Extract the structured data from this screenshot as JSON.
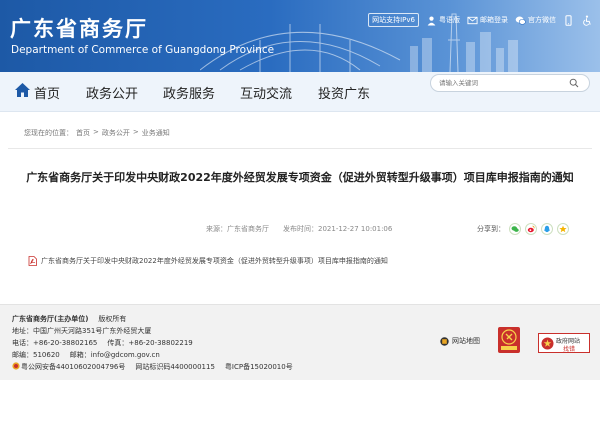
{
  "header": {
    "title": "广东省商务厅",
    "subtitle": "Department of Commerce of Guangdong Province",
    "ipv6_badge": "网站支持IPv6",
    "links": [
      {
        "label": "粤语版",
        "icon": "person-icon"
      },
      {
        "label": "邮箱登录",
        "icon": "mail-icon"
      },
      {
        "label": "官方微信",
        "icon": "wechat-icon"
      },
      {
        "label": "",
        "icon": "mobile-icon"
      },
      {
        "label": "",
        "icon": "accessibility-icon"
      }
    ]
  },
  "nav": {
    "items": [
      "首页",
      "政务公开",
      "政务服务",
      "互动交流",
      "投资广东"
    ],
    "search_placeholder": "请输入关键词"
  },
  "breadcrumb": {
    "prefix": "您现在的位置：",
    "items": [
      "首页",
      "政务公开",
      "业务通知"
    ],
    "separator": ">"
  },
  "article": {
    "title": "广东省商务厅关于印发中央财政2022年度外经贸发展专项资金（促进外贸转型升级事项）项目库申报指南的通知",
    "source": "来源：广东省商务厅",
    "time": "发布时间：2021-12-27 10:01:06",
    "share_label": "分享到：",
    "share_icons": [
      "wechat-icon",
      "weibo-icon",
      "qq-icon",
      "qzone-icon"
    ],
    "attachment": "广东省商务厅关于印发中央财政2022年度外经贸发展专项资金（促进外贸转型升级事项）项目库申报指南的通知"
  },
  "footer": {
    "org": "广东省商务厅(主办单位)",
    "rights": "版权所有",
    "address": "地址：中国广州天河路351号广东外经贸大厦",
    "phone": "电话：+86-20-38802165",
    "fax": "传真：+86-20-38802219",
    "postcode": "邮编：510620",
    "email": "邮箱：info@gdcom.gov.cn",
    "police": "粤公网安备44010602004796号",
    "site_code": "网站标识码4400000115",
    "icp": "粤ICP备15020010号",
    "sitemap": "网站地图",
    "gov_badge_line1": "政府网站",
    "gov_badge_line2": "找错"
  },
  "colors": {
    "banner_start": "#1d59a6",
    "banner_end": "#9bc0ea",
    "nav_bg": "#eef4fb",
    "footer_bg": "#f2f2f2",
    "badge_red": "#c9302c"
  }
}
